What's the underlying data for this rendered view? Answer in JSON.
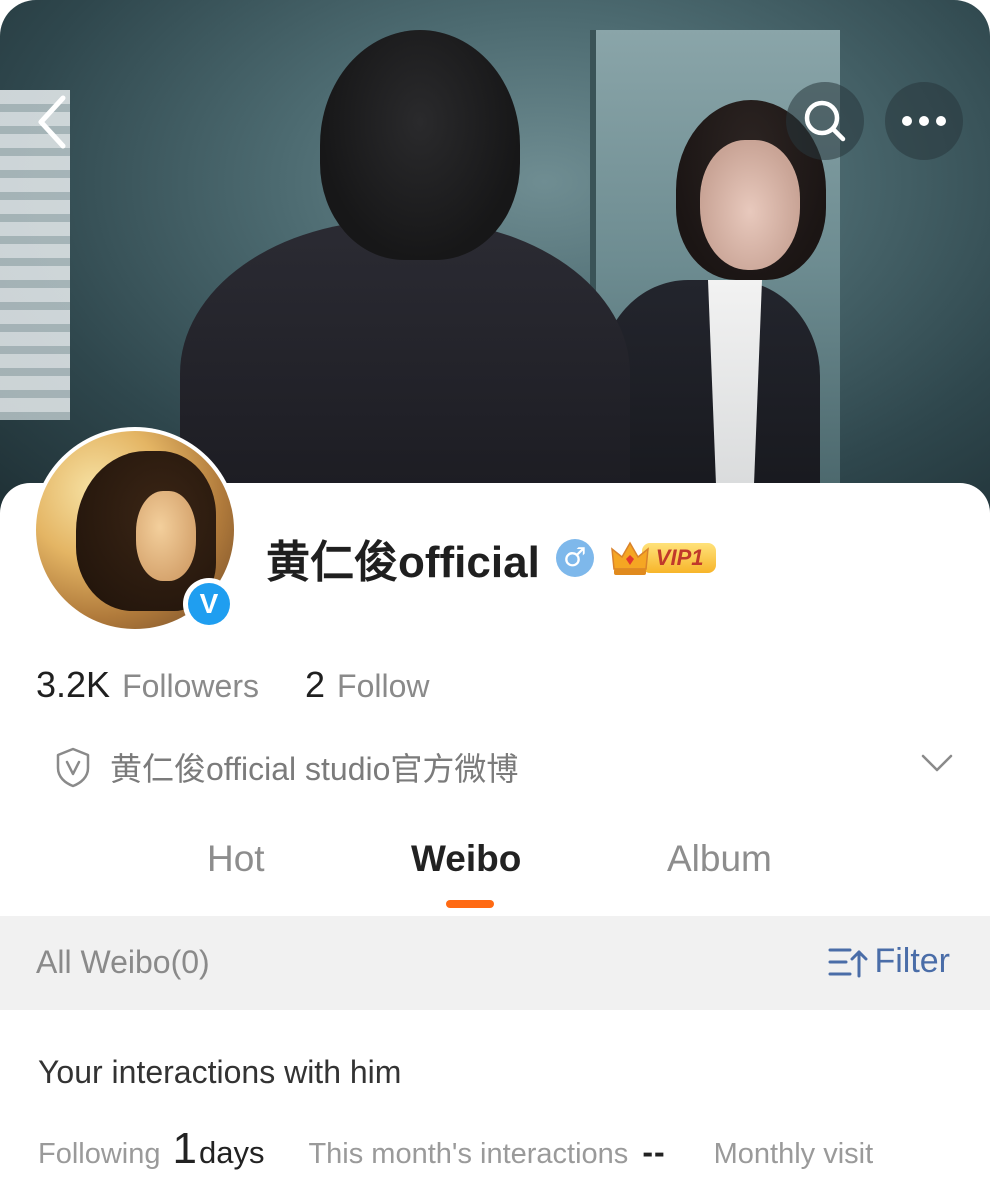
{
  "header": {
    "back_icon": "chevron-left-icon",
    "search_icon": "search-icon",
    "more_icon": "more-dots-icon"
  },
  "profile": {
    "name": "黄仁俊official",
    "gender_symbol": "♂",
    "vip_label": "VIP1",
    "verified_badge": "V",
    "followers_count": "3.2K",
    "followers_label": "Followers",
    "follow_count": "2",
    "follow_label": "Follow",
    "bio": "黄仁俊official studio官方微博"
  },
  "tabs": [
    {
      "label": "Hot"
    },
    {
      "label": "Weibo"
    },
    {
      "label": "Album"
    }
  ],
  "active_tab": "Weibo",
  "filter_bar": {
    "all_weibo": "All Weibo(0)",
    "filter_label": "Filter"
  },
  "interactions": {
    "title": "Your interactions with him",
    "following_label": "Following",
    "following_value": "1",
    "following_unit": "days",
    "month_label": "This month's interactions",
    "month_value": "--",
    "visits_label": "Monthly visit"
  },
  "colors": {
    "accent": "#ff6a13",
    "filter_blue": "#4a6da8",
    "verified_blue": "#1f9ef0",
    "vip_gold": "#f7b52a"
  }
}
